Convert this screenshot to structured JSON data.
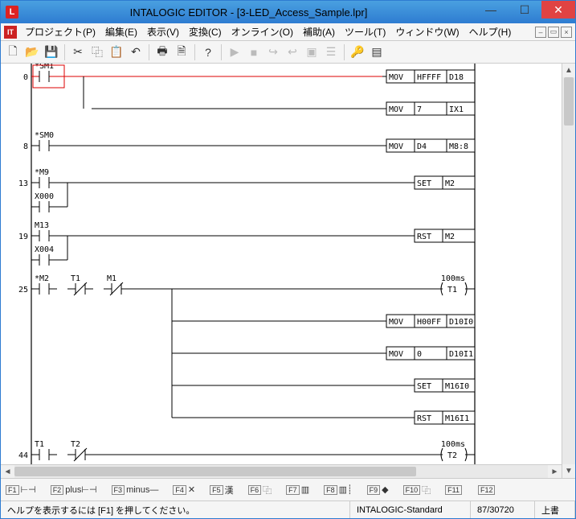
{
  "window": {
    "title": "INTALOGIC EDITOR - [3-LED_Access_Sample.lpr]",
    "app_icon_letter": "L",
    "logo_letter": "IT"
  },
  "menu": {
    "items": [
      "プロジェクト(P)",
      "編集(E)",
      "表示(V)",
      "変換(C)",
      "オンライン(O)",
      "補助(A)",
      "ツール(T)",
      "ウィンドウ(W)",
      "ヘルプ(H)"
    ]
  },
  "toolbar": {
    "buttons": [
      {
        "name": "new-icon",
        "glyph": "🗋"
      },
      {
        "name": "open-icon",
        "glyph": "📂"
      },
      {
        "name": "save-icon",
        "glyph": "💾"
      },
      {
        "sep": true
      },
      {
        "name": "cut-icon",
        "glyph": "✂"
      },
      {
        "name": "copy-icon",
        "glyph": "⿻"
      },
      {
        "name": "paste-icon",
        "glyph": "📋"
      },
      {
        "name": "undo-icon",
        "glyph": "↶"
      },
      {
        "sep": true
      },
      {
        "name": "print-icon",
        "glyph": "🖶"
      },
      {
        "name": "preview-icon",
        "glyph": "🗎"
      },
      {
        "sep": true
      },
      {
        "name": "help-icon",
        "glyph": "?"
      },
      {
        "sep": true
      },
      {
        "name": "run-icon",
        "glyph": "▶",
        "dis": true
      },
      {
        "name": "stop-icon",
        "glyph": "■",
        "dis": true
      },
      {
        "name": "step-icon",
        "glyph": "↪",
        "dis": true
      },
      {
        "name": "step2-icon",
        "glyph": "↩",
        "dis": true
      },
      {
        "name": "monitor-icon",
        "glyph": "▣",
        "dis": true
      },
      {
        "name": "trace-icon",
        "glyph": "☰",
        "dis": true
      },
      {
        "sep": true
      },
      {
        "name": "key-icon",
        "glyph": "🔑"
      },
      {
        "name": "pane-icon",
        "glyph": "▤"
      }
    ]
  },
  "ladder": {
    "rungs": [
      {
        "step": 0,
        "contacts": [
          {
            "label": "*SM1",
            "type": "no",
            "highlight": true
          }
        ],
        "outputs": [
          {
            "op": "MOV",
            "a": "HFFFF",
            "b": "D18"
          },
          {
            "op": "MOV",
            "a": "7",
            "b": "IX1"
          }
        ]
      },
      {
        "step": 8,
        "contacts": [
          {
            "label": "*SM0",
            "type": "no"
          }
        ],
        "outputs": [
          {
            "op": "MOV",
            "a": "D4",
            "b": "M8:8"
          }
        ]
      },
      {
        "step": 13,
        "contacts": [
          {
            "label": "*M9",
            "type": "no"
          },
          {
            "label": "X000",
            "type": "no",
            "row": 1
          }
        ],
        "outputs": [
          {
            "op": "SET",
            "a": "M2"
          }
        ]
      },
      {
        "step": 19,
        "contacts": [
          {
            "label": "M13",
            "type": "no"
          },
          {
            "label": "X004",
            "type": "no",
            "row": 1
          }
        ],
        "outputs": [
          {
            "op": "RST",
            "a": "M2"
          }
        ]
      },
      {
        "step": 25,
        "contacts": [
          {
            "label": "*M2",
            "type": "no"
          },
          {
            "label": "T1",
            "type": "nc",
            "col": 1
          },
          {
            "label": "M1",
            "type": "nc",
            "col": 2
          }
        ],
        "outputs": [
          {
            "op": "TMR",
            "a": "T1",
            "note": "100ms",
            "coil": true
          },
          {
            "op": "MOV",
            "a": "H00FF",
            "b": "D10I0"
          },
          {
            "op": "MOV",
            "a": "0",
            "b": "D10I1"
          },
          {
            "op": "SET",
            "a": "M16I0"
          },
          {
            "op": "RST",
            "a": "M16I1"
          }
        ],
        "branch_col": 3
      },
      {
        "step": 44,
        "contacts": [
          {
            "label": "T1",
            "type": "no"
          },
          {
            "label": "T2",
            "type": "nc",
            "col": 1
          }
        ],
        "outputs": [
          {
            "op": "TMR",
            "a": "T2",
            "note": "100ms",
            "coil": true
          }
        ]
      }
    ]
  },
  "fnbar": {
    "items": [
      {
        "key": "F1",
        "label": "⊢⊣"
      },
      {
        "key": "F2",
        "label": "plus⊢⊣"
      },
      {
        "key": "F3",
        "label": "minus—"
      },
      {
        "key": "F4",
        "label": "✕"
      },
      {
        "key": "F5",
        "label": "漢"
      },
      {
        "key": "F6",
        "label": "⿻"
      },
      {
        "key": "F7",
        "label": "▥"
      },
      {
        "key": "F8",
        "label": "▥┊"
      },
      {
        "key": "F9",
        "label": "◆"
      },
      {
        "key": "F10",
        "label": "⿻"
      },
      {
        "key": "F11",
        "label": ""
      },
      {
        "key": "F12",
        "label": ""
      }
    ]
  },
  "status": {
    "hint": "ヘルプを表示するには [F1] を押してください。",
    "mode": "INTALOGIC-Standard",
    "steps": "87/30720",
    "edit": "上書"
  }
}
